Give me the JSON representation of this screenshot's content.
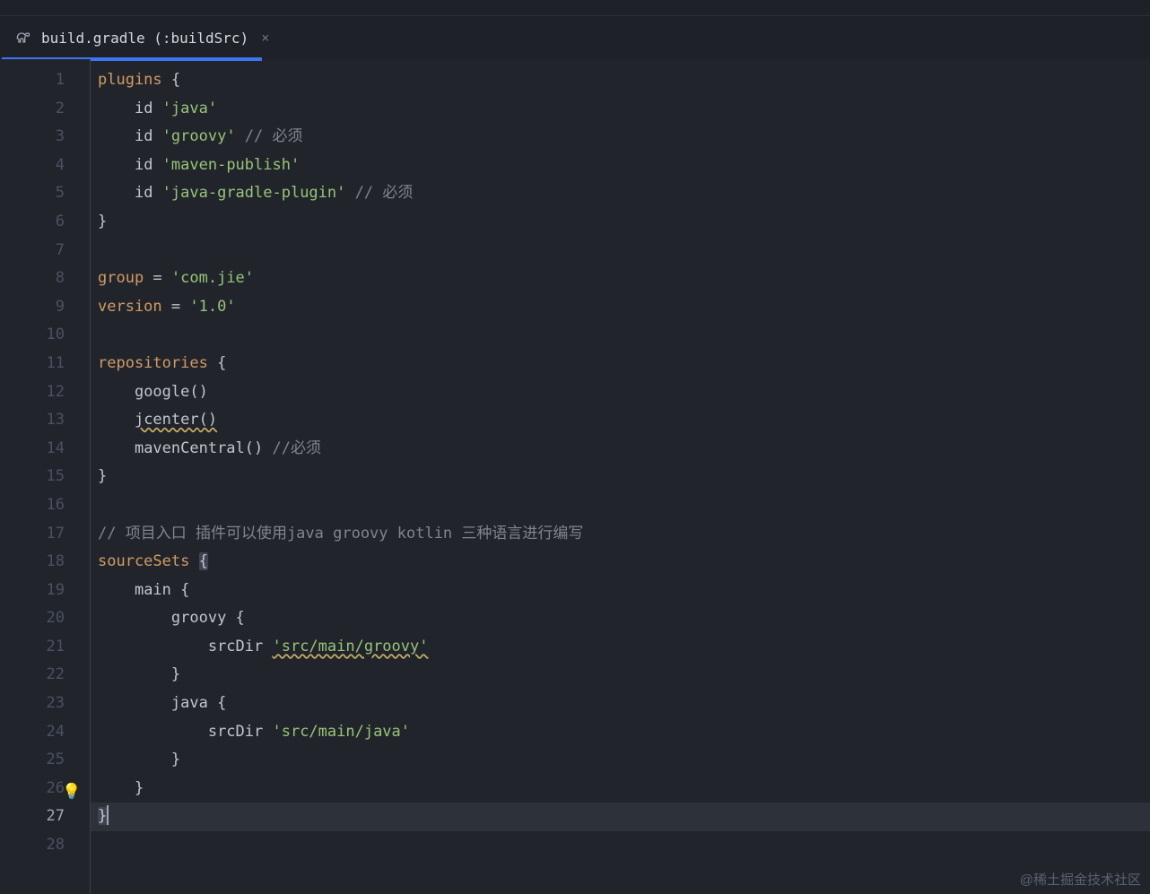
{
  "tab": {
    "title": "build.gradle (:buildSrc)",
    "close_symbol": "×"
  },
  "lines": {
    "ln1": "1",
    "ln2": "2",
    "ln3": "3",
    "ln4": "4",
    "ln5": "5",
    "ln6": "6",
    "ln7": "7",
    "ln8": "8",
    "ln9": "9",
    "ln10": "10",
    "ln11": "11",
    "ln12": "12",
    "ln13": "13",
    "ln14": "14",
    "ln15": "15",
    "ln16": "16",
    "ln17": "17",
    "ln18": "18",
    "ln19": "19",
    "ln20": "20",
    "ln21": "21",
    "ln22": "22",
    "ln23": "23",
    "ln24": "24",
    "ln25": "25",
    "ln26": "26",
    "ln27": "27",
    "ln28": "28"
  },
  "code": {
    "plugins_kw": "plugins ",
    "brace_open": "{",
    "brace_close": "}",
    "indent4": "    ",
    "indent8": "        ",
    "indent12": "            ",
    "id_kw": "id ",
    "str_java": "'java'",
    "str_groovy": "'groovy'",
    "comment_must": " // 必须",
    "str_maven_publish": "'maven-publish'",
    "str_java_gradle": "'java-gradle-plugin'",
    "group_kw": "group",
    "eq": " = ",
    "str_com_jie": "'com.jie'",
    "version_kw": "version",
    "str_ver": "'1.0'",
    "repos_kw": "repositories ",
    "google_call": "google",
    "parens": "()",
    "jcenter_call": "jcenter",
    "mavenCentral_call": "mavenCentral",
    "comment_must2": " //必须",
    "comment_entry": "// 项目入口 插件可以使用java groovy kotlin 三种语言进行编写",
    "sourceSets_kw": "sourceSets ",
    "main_kw": "main ",
    "groovy_kw": "groovy ",
    "java_kw": "java ",
    "srcDir_kw": "srcDir ",
    "str_src_groovy": "'src/main/groovy'",
    "str_src_java": "'src/main/java'"
  },
  "watermark": "@稀土掘金技术社区",
  "bulb_symbol": "💡"
}
